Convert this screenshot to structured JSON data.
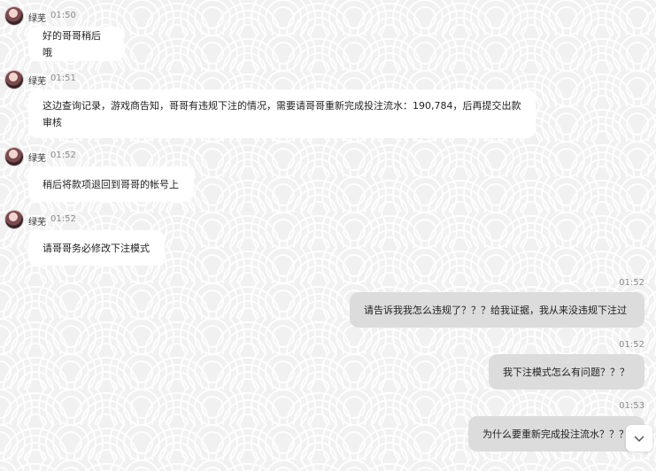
{
  "chat": {
    "incoming": [
      {
        "name": "绿芜",
        "time": "01:50",
        "text": "好的哥哥稍后哦"
      },
      {
        "name": "绿芜",
        "time": "01:51",
        "text": "这边查询记录，游戏商告知，哥哥有违规下注的情况，需要请哥哥重新完成投注流水：190,784，后再提交出款审核"
      },
      {
        "name": "绿芜",
        "time": "01:52",
        "text": "稍后将款项退回到哥哥的帐号上"
      },
      {
        "name": "绿芜",
        "time": "01:52",
        "text": "请哥哥务必修改下注模式"
      }
    ],
    "outgoing": [
      {
        "time": "01:52",
        "text": "请告诉我我怎么违规了？？？给我证据，我从来没违规下注过"
      },
      {
        "time": "01:52",
        "text": "我下注模式怎么有问题？？？"
      },
      {
        "time": "01:53",
        "text": "为什么要重新完成投注流水？？？"
      }
    ]
  },
  "icons": {
    "avatar": "avatar-image",
    "scroll_down": "chevron-down-icon"
  },
  "colors": {
    "background": "#f3f3f3",
    "incoming_bubble": "#ffffff",
    "outgoing_bubble": "#dcdcdc",
    "time_text": "#8a8a8a"
  }
}
